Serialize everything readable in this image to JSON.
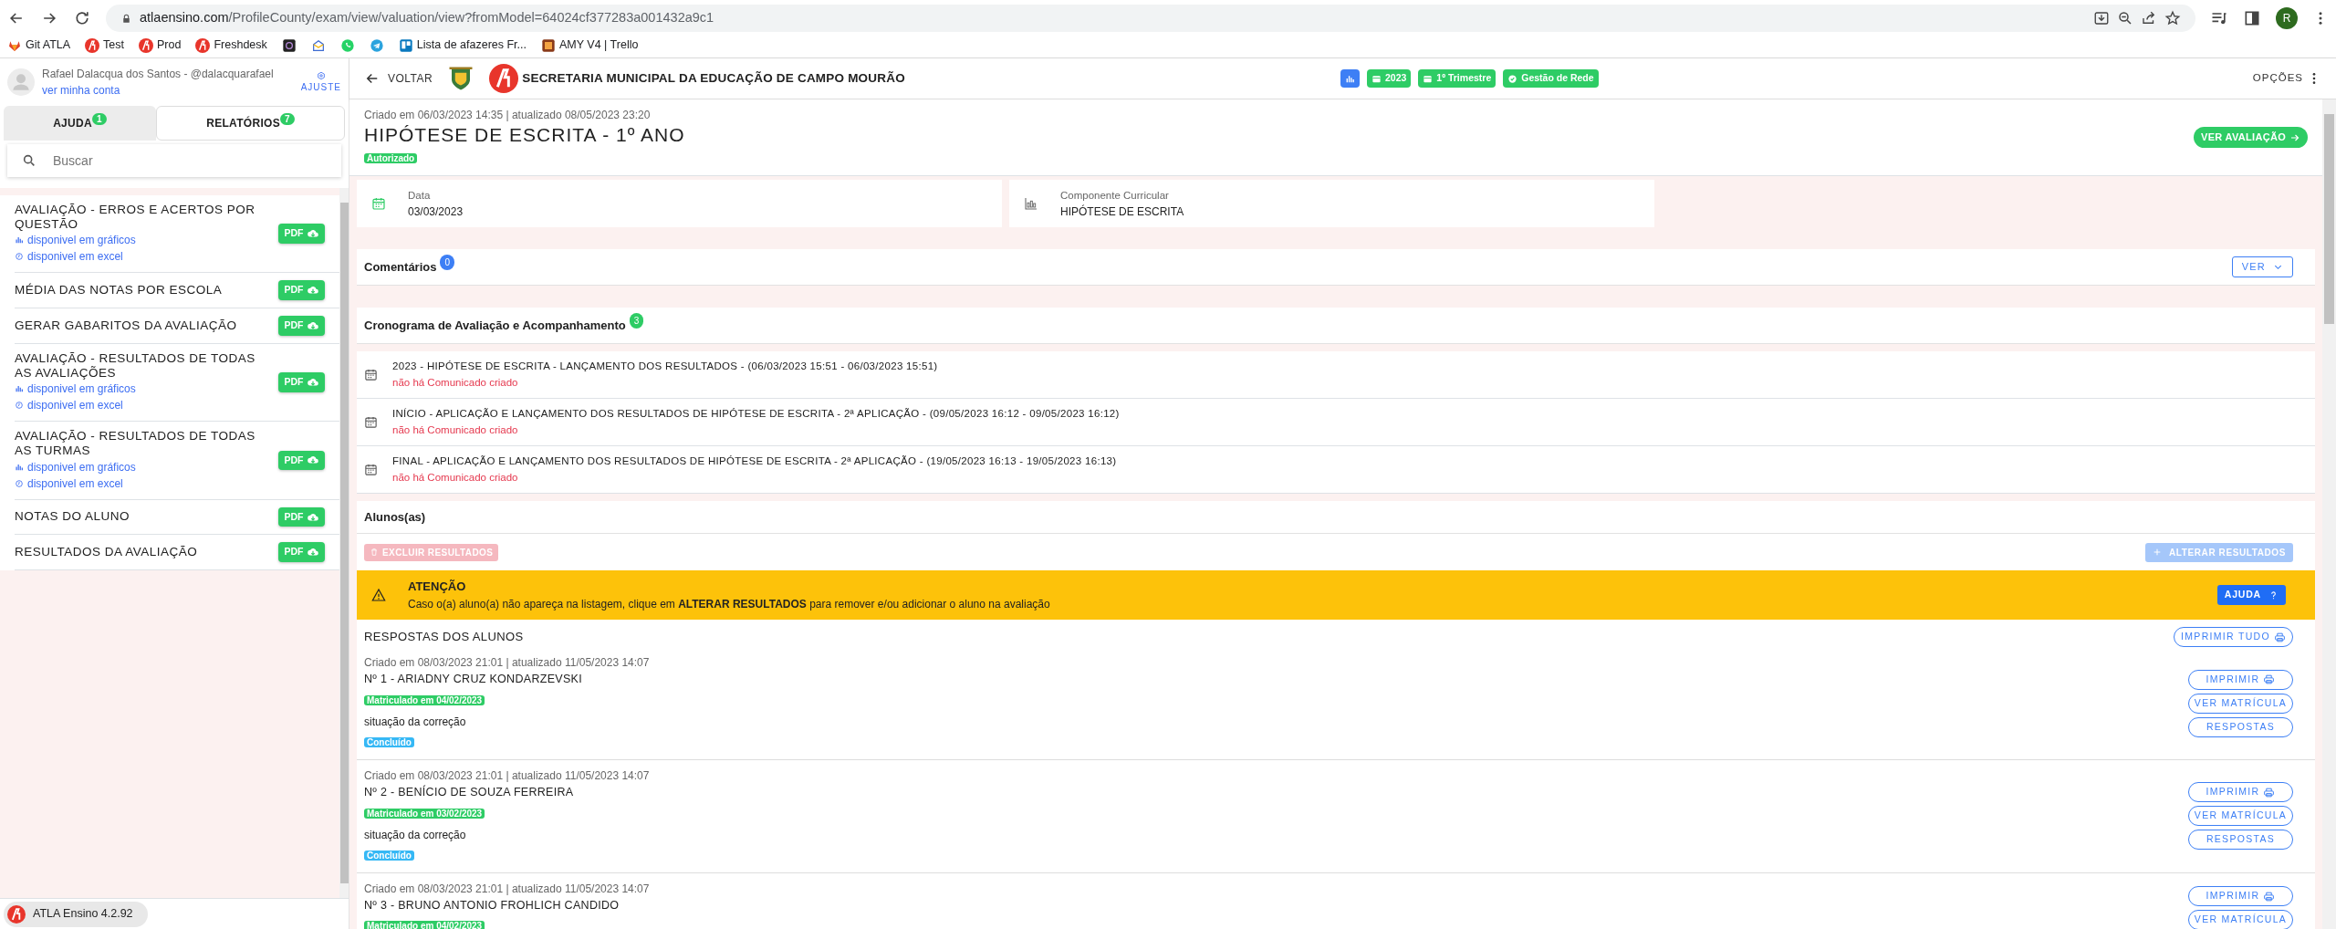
{
  "browser": {
    "url": "atlaensino.com/ProfileCounty/exam/view/valuation/view?fromModel=64024cf377283a001432a9c1",
    "profile_initial": "R",
    "bookmarks": [
      {
        "kind": "gitlab",
        "label": "Git ATLA"
      },
      {
        "kind": "atla",
        "label": "Test"
      },
      {
        "kind": "atla",
        "label": "Prod"
      },
      {
        "kind": "atla",
        "label": "Freshdesk"
      },
      {
        "kind": "openai"
      },
      {
        "kind": "mail"
      },
      {
        "kind": "whatsapp"
      },
      {
        "kind": "telegram"
      },
      {
        "kind": "trello",
        "label": "Lista de afazeres Fr..."
      },
      {
        "kind": "amy",
        "label": "AMY V4 | Trello"
      }
    ]
  },
  "sidebar": {
    "user": {
      "name": "Rafael Dalacqua dos Santos - @dalacquarafael",
      "link": "ver minha conta",
      "settings": "AJUSTE"
    },
    "tabs": [
      {
        "label": "AJUDA",
        "count": "1",
        "selected": false
      },
      {
        "label": "RELATÓRIOS",
        "count": "7",
        "selected": true
      }
    ],
    "search": {
      "placeholder": "Buscar"
    },
    "reports": [
      {
        "title": "AVALIAÇÃO - ERROS E ACERTOS POR QUESTÃO",
        "button": "PDF",
        "links": [
          {
            "kind": "chart",
            "label": "disponivel em gráficos"
          },
          {
            "kind": "clock",
            "label": "disponivel em excel"
          }
        ]
      },
      {
        "title": "MÉDIA DAS NOTAS POR ESCOLA",
        "button": "PDF"
      },
      {
        "title": "GERAR GABARITOS DA AVALIAÇÃO",
        "button": "PDF"
      },
      {
        "title": "AVALIAÇÃO - RESULTADOS DE TODAS AS AVALIAÇÕES",
        "button": "PDF",
        "links": [
          {
            "kind": "chart",
            "label": "disponivel em gráficos"
          },
          {
            "kind": "clock",
            "label": "disponivel em excel"
          }
        ]
      },
      {
        "title": "AVALIAÇÃO - RESULTADOS DE TODAS AS TURMAS",
        "button": "PDF",
        "links": [
          {
            "kind": "chart",
            "label": "disponivel em gráficos"
          },
          {
            "kind": "clock",
            "label": "disponivel em excel"
          }
        ]
      },
      {
        "title": "NOTAS DO ALUNO",
        "button": "PDF"
      },
      {
        "title": "RESULTADOS DA AVALIAÇÃO",
        "button": "PDF"
      }
    ],
    "footer": "ATLA Ensino 4.2.92"
  },
  "header": {
    "back": "VOLTAR",
    "organization": "SECRETARIA MUNICIPAL DA EDUCAÇÃO DE CAMPO MOURÃO",
    "tags": [
      {
        "kind": "chart",
        "color": "#3d7ff5"
      },
      {
        "kind": "calendar",
        "label": "2023",
        "color": "#2ecc65"
      },
      {
        "kind": "calendar",
        "label": "1º Trimestre",
        "color": "#2ecc65"
      },
      {
        "kind": "check",
        "label": "Gestão de Rede",
        "color": "#2ecc65"
      }
    ],
    "options": "OPÇÕES"
  },
  "evaluation": {
    "meta": "Criado em 06/03/2023 14:35 | atualizado 08/05/2023 23:20",
    "title": "HIPÓTESE DE ESCRITA - 1º ANO",
    "status": "Autorizado",
    "view_button": "VER AVALIAÇÃO"
  },
  "info": [
    {
      "kind": "calendar",
      "label": "Data",
      "value": "03/03/2023"
    },
    {
      "kind": "chart",
      "label": "Componente Curricular",
      "value": "HIPÓTESE DE ESCRITA"
    }
  ],
  "comments": {
    "title": "Comentários",
    "count": "0",
    "button": "VER"
  },
  "schedule": {
    "title": "Cronograma de Avaliação e Acompanhamento",
    "count": "3",
    "items": [
      {
        "title": "2023 - HIPÓTESE DE ESCRITA - LANÇAMENTO DOS RESULTADOS - (06/03/2023 15:51 - 06/03/2023 15:51)",
        "note": "não há Comunicado criado"
      },
      {
        "title": "INÍCIO - APLICAÇÃO E LANÇAMENTO DOS RESULTADOS DE HIPÓTESE DE ESCRITA - 2ª APLICAÇÃO - (09/05/2023 16:12 - 09/05/2023 16:12)",
        "note": "não há Comunicado criado"
      },
      {
        "title": "FINAL - APLICAÇÃO E LANÇAMENTO DOS RESULTADOS DE HIPÓTESE DE ESCRITA - 2ª APLICAÇÃO - (19/05/2023 16:13 - 19/05/2023 16:13)",
        "note": "não há Comunicado criado"
      }
    ]
  },
  "students_section": {
    "title": "Alunos(as)",
    "delete_button": {
      "label": "EXCLUIR RESULTADOS",
      "disabled": true
    },
    "change_button": {
      "label": "ALTERAR RESULTADOS",
      "disabled": true
    },
    "alert": {
      "title": "ATENÇÃO",
      "text": "Caso o(a) aluno(a) não apareça na listagem, clique em **ALTERAR RESULTADOS** para remover e/ou adicionar o aluno na avaliação",
      "button": "AJUDA"
    },
    "answers_title": "RESPOSTAS DOS ALUNOS",
    "print_all": "IMPRIMIR TUDO",
    "students": [
      {
        "meta": "Criado em 08/03/2023 21:01 | atualizado 11/05/2023 14:07",
        "name": "Nº 1 - ARIADNY CRUZ KONDARZEVSKI",
        "enrollment": "Matriculado em 04/02/2023",
        "status_label": "situação da correção",
        "status": "Concluído",
        "buttons": [
          {
            "kind": "print",
            "label": "IMPRIMIR"
          },
          {
            "kind": "plain",
            "label": "VER MATRÍCULA"
          },
          {
            "kind": "plain",
            "label": "RESPOSTAS"
          }
        ]
      },
      {
        "meta": "Criado em 08/03/2023 21:01 | atualizado 11/05/2023 14:07",
        "name": "Nº 2 - BENÍCIO DE SOUZA FERREIRA",
        "enrollment": "Matriculado em 03/02/2023",
        "status_label": "situação da correção",
        "status": "Concluído",
        "buttons": [
          {
            "kind": "print",
            "label": "IMPRIMIR"
          },
          {
            "kind": "plain",
            "label": "VER MATRÍCULA"
          },
          {
            "kind": "plain",
            "label": "RESPOSTAS"
          }
        ]
      },
      {
        "meta": "Criado em 08/03/2023 21:01 | atualizado 11/05/2023 14:07",
        "name": "Nº 3 - BRUNO ANTONIO FROHLICH CANDIDO",
        "enrollment": "Matriculado em 04/02/2023",
        "buttons": [
          {
            "kind": "print",
            "label": "IMPRIMIR"
          },
          {
            "kind": "plain",
            "label": "VER MATRÍCULA"
          }
        ]
      }
    ]
  }
}
